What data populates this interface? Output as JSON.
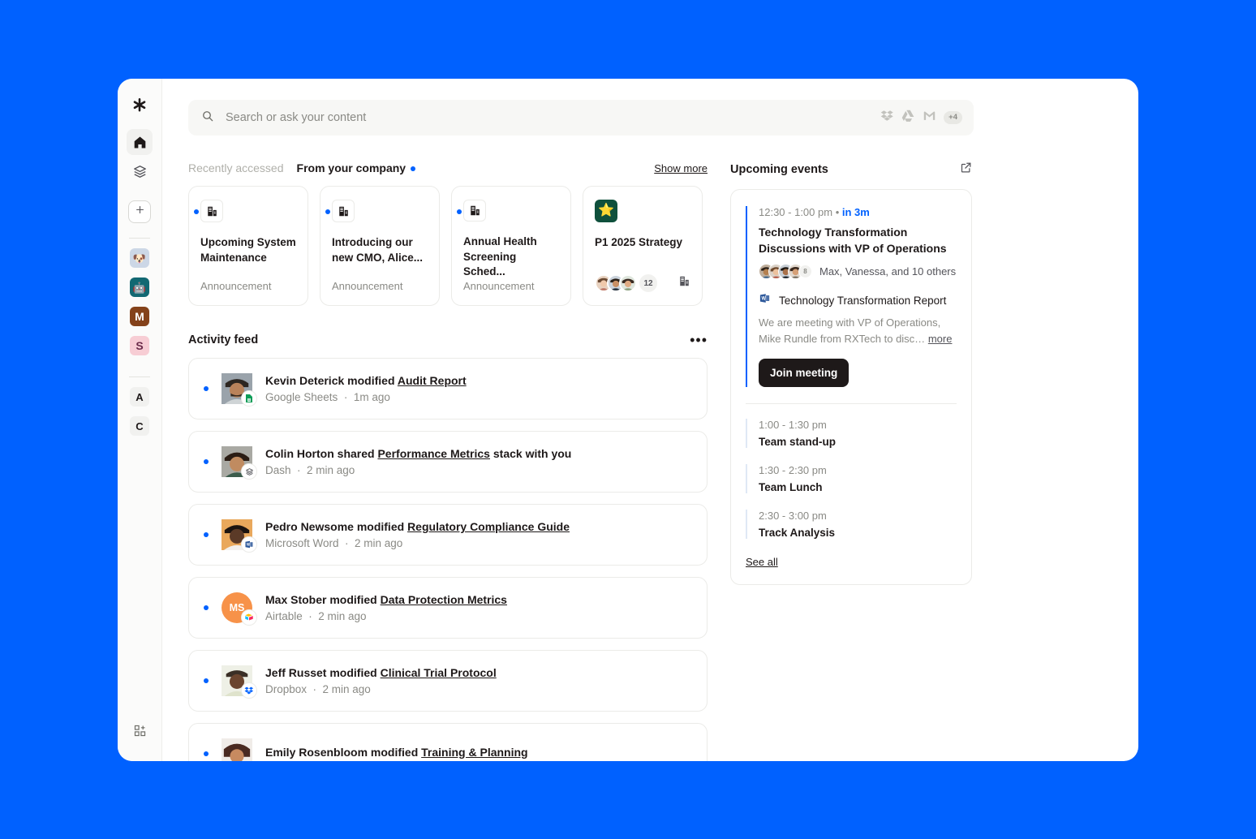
{
  "theme": {
    "background": "#0061FF",
    "accent": "#0061FF",
    "text": "#1e1919",
    "muted": "#8a8a85"
  },
  "sidebar": {
    "logo": "asterisk-logo",
    "items": [
      {
        "name": "home",
        "icon": "home-icon",
        "active": true
      },
      {
        "name": "stacks",
        "icon": "layers-icon",
        "active": false
      }
    ],
    "create": {
      "label": "+",
      "icon": "plus-icon"
    },
    "apps": [
      {
        "name": "dog-app",
        "glyph": "🐶",
        "bg": "#ccd7e6"
      },
      {
        "name": "robot-app",
        "glyph": "🤖",
        "bg": "#126872"
      },
      {
        "name": "m-app",
        "glyph": "M",
        "bg": "#84421a",
        "color": "#ffffff"
      },
      {
        "name": "s-app",
        "glyph": "S",
        "bg": "#f7cdd4",
        "color": "#6b2b4a"
      }
    ],
    "letters": [
      {
        "name": "a-workspace",
        "glyph": "A"
      },
      {
        "name": "c-workspace",
        "glyph": "C"
      }
    ],
    "bottom": {
      "name": "add-apps",
      "icon": "grid-plus-icon"
    }
  },
  "search": {
    "placeholder": "Search or ask your content",
    "icon": "search-icon",
    "connected_apps": [
      "dropbox-icon",
      "google-drive-icon",
      "gmail-icon"
    ],
    "more_count": "+4"
  },
  "recent": {
    "tabs": [
      {
        "label": "Recently accessed",
        "active": false
      },
      {
        "label": "From your company",
        "active": true,
        "dot": true
      }
    ],
    "show_more": "Show more",
    "cards": [
      {
        "title": "Upcoming System Maintenance",
        "subtitle": "Announcement",
        "icon": "announcement-doc-icon",
        "unread": true
      },
      {
        "title": "Introducing our new CMO, Alice...",
        "subtitle": "Announcement",
        "icon": "announcement-doc-icon",
        "unread": true
      },
      {
        "title": "Annual Health Screening Sched...",
        "subtitle": "Announcement",
        "icon": "announcement-doc-icon",
        "unread": true
      },
      {
        "title": "P1 2025 Strategy",
        "subtitle": "",
        "icon": "star-icon",
        "unread": false,
        "member_count": "12",
        "doc_icon": "announcement-doc-icon"
      }
    ]
  },
  "activity": {
    "title": "Activity feed",
    "menu": "•••",
    "items": [
      {
        "actor": "Kevin Deterick",
        "verb": "modified",
        "target": "Audit Report",
        "tail": "",
        "app": "Google Sheets",
        "time": "1m ago",
        "badge": "google-sheets-icon"
      },
      {
        "actor": "Colin Horton",
        "verb": "shared",
        "target": "Performance Metrics",
        "tail": "stack with you",
        "app": "Dash",
        "time": "2 min ago",
        "badge": "dash-layers-icon"
      },
      {
        "actor": "Pedro Newsome",
        "verb": "modified",
        "target": "Regulatory Compliance Guide",
        "tail": "",
        "app": "Microsoft Word",
        "time": "2 min ago",
        "badge": "microsoft-word-icon"
      },
      {
        "actor": "Max Stober",
        "verb": "modified",
        "target": "Data Protection Metrics",
        "tail": "",
        "app": "Airtable",
        "time": "2 min ago",
        "badge": "airtable-icon",
        "initials": "MS"
      },
      {
        "actor": "Jeff Russet",
        "verb": "modified",
        "target": "Clinical Trial Protocol",
        "tail": "",
        "app": "Dropbox",
        "time": "2 min ago",
        "badge": "dropbox-icon"
      },
      {
        "actor": "Emily Rosenbloom",
        "verb": "modified",
        "target": "Training & Planning",
        "tail": "",
        "app": "",
        "time": "",
        "badge": ""
      }
    ]
  },
  "events": {
    "title": "Upcoming events",
    "open_icon": "external-link-icon",
    "featured": {
      "time": "12:30 - 1:00 pm",
      "separator": "•",
      "relative": "in 3m",
      "title": "Technology Transformation Discussions with VP of Operations",
      "attendees_text": "Max, Vanessa, and 10 others",
      "attendee_overflow": "8",
      "doc_icon": "microsoft-word-icon",
      "doc_title": "Technology Transformation Report",
      "description": "We are meeting with VP of Operations, Mike Rundle from RXTech to disc…",
      "more": "more",
      "join_label": "Join meeting"
    },
    "upcoming": [
      {
        "time": "1:00 - 1:30 pm",
        "name": "Team stand-up"
      },
      {
        "time": "1:30 - 2:30 pm",
        "name": "Team Lunch"
      },
      {
        "time": "2:30 - 3:00 pm",
        "name": "Track Analysis"
      }
    ],
    "see_all": "See all"
  }
}
